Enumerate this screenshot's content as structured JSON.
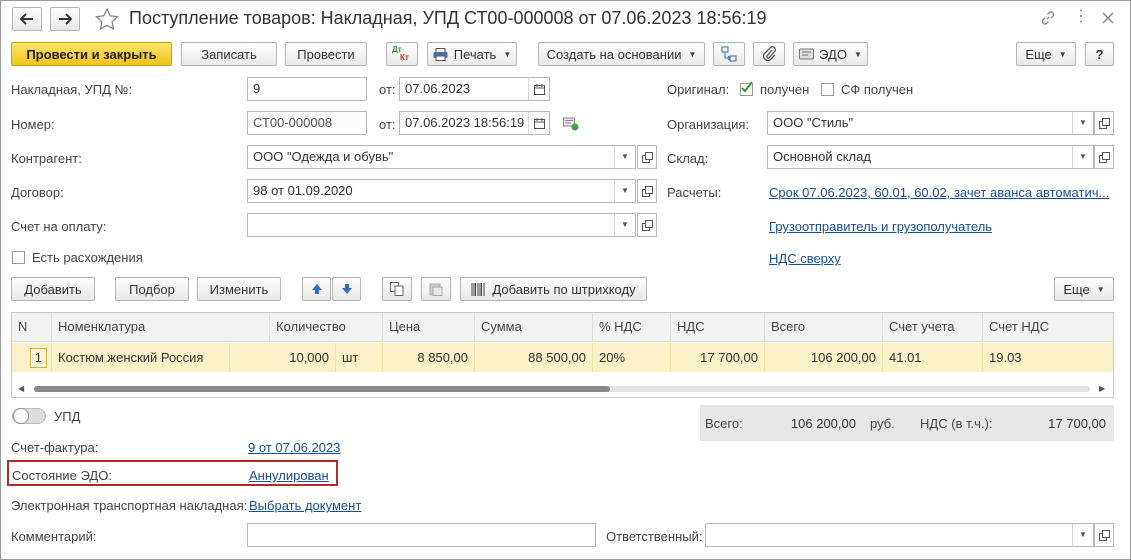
{
  "window": {
    "title": "Поступление товаров: Накладная, УПД СТ00-000008 от 07.06.2023 18:56:19"
  },
  "toolbar": {
    "post_close": "Провести и закрыть",
    "write": "Записать",
    "post": "Провести",
    "dtkt_dt": "Дт",
    "dtkt_kt": "Кт",
    "print": "Печать",
    "create_based": "Создать на основании",
    "edo": "ЭДО",
    "more": "Еще",
    "help": "?"
  },
  "form": {
    "invoice_label": "Накладная, УПД №:",
    "invoice_value": "9",
    "from_label": "от:",
    "invoice_date": "07.06.2023",
    "number_label": "Номер:",
    "number_value": "СТ00-000008",
    "number_date": "07.06.2023 18:56:19",
    "counterparty_label": "Контрагент:",
    "counterparty_value": "ООО \"Одежда и обувь\"",
    "contract_label": "Договор:",
    "contract_value": "98 от 01.09.2020",
    "payment_label": "Счет на оплату:",
    "payment_value": "",
    "discrepancies_label": "Есть расхождения",
    "original_label": "Оригинал:",
    "original_received": "получен",
    "sf_received": "СФ получен",
    "org_label": "Организация:",
    "org_value": "ООО \"Стиль\"",
    "warehouse_label": "Склад:",
    "warehouse_value": "Основной склад",
    "settlements_label": "Расчеты:",
    "settlements_link": "Срок 07.06.2023, 60.01, 60.02, зачет аванса автоматич...",
    "shipper_link": "Грузоотправитель и грузополучатель",
    "vat_link": "НДС сверху"
  },
  "table_toolbar": {
    "add": "Добавить",
    "select": "Подбор",
    "edit": "Изменить",
    "barcode": "Добавить по штрихкоду",
    "more": "Еще"
  },
  "table": {
    "headers": [
      "N",
      "Номенклатура",
      "Количество",
      "Цена",
      "Сумма",
      "% НДС",
      "НДС",
      "Всего",
      "Счет учета",
      "Счет НДС"
    ],
    "rows": [
      {
        "n": "1",
        "item": "Костюм женский Россия",
        "qty": "10,000",
        "unit": "шт",
        "price": "8 850,00",
        "sum": "88 500,00",
        "vat_rate": "20%",
        "vat": "17 700,00",
        "total": "106 200,00",
        "account": "41.01",
        "vat_account": "19.03"
      }
    ]
  },
  "footer": {
    "upd_label": "УПД",
    "total_label": "Всего:",
    "total_value": "106 200,00",
    "currency": "руб.",
    "vat_label": "НДС (в т.ч.):",
    "vat_value": "17 700,00",
    "sf_label": "Счет-фактура:",
    "sf_link": "9 от 07.06.2023",
    "edo_state_label": "Состояние ЭДО:",
    "edo_state_link": "Аннулирован",
    "ettn_label": "Электронная транспортная накладная:",
    "ettn_link": "Выбрать документ",
    "comment_label": "Комментарий:",
    "comment_value": "",
    "responsible_label": "Ответственный:",
    "responsible_value": ""
  },
  "colors": {
    "primary_button": "#f2c41c",
    "selected_row": "#faf1c8",
    "link": "#1a4e96",
    "highlight_border": "#b72a2a",
    "checkbox_check": "#2e9a2e"
  }
}
